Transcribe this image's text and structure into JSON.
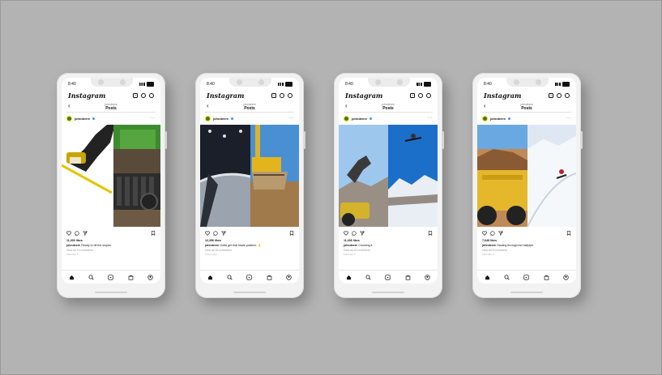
{
  "phones": [
    {
      "time": "8:40",
      "logo": "Instagram",
      "sub_user": "johndeere",
      "sub_title": "Posts",
      "account": "johndeere",
      "likes": "11,400 likes",
      "caption_user": "johndeere",
      "caption_text": "Ready to hit the slopes.",
      "comments": "View all 13 comments",
      "date": "February 6"
    },
    {
      "time": "8:40",
      "logo": "Instagram",
      "sub_user": "johndeere",
      "sub_title": "Posts",
      "account": "johndeere",
      "likes": "12,356 likes",
      "caption_user": "johndeere",
      "caption_text": "Gotta get that blade position. 👌",
      "comments": "View all 18 comments",
      "date": "2 days ago"
    },
    {
      "time": "8:40",
      "logo": "Instagram",
      "sub_user": "johndeere",
      "sub_title": "Posts",
      "account": "johndeere",
      "likes": "11,406 likes",
      "caption_user": "johndeere",
      "caption_text": "Crushing it.",
      "comments": "View all 22 comments",
      "date": "February 6"
    },
    {
      "time": "8:40",
      "logo": "Instagram",
      "sub_user": "johndeere",
      "sub_title": "Posts",
      "account": "johndeere",
      "likes": "7,648 likes",
      "caption_user": "johndeere",
      "caption_text": "Hauling through the halfpipe.",
      "comments": "View all 8 comments",
      "date": "February 6"
    }
  ],
  "colors": {
    "background": "#b3b3b3",
    "phone_body": "#f2f2f2",
    "deere_green": "#367c2b",
    "deere_yellow": "#ffde00",
    "verified_blue": "#3897f0"
  },
  "icons": {
    "header": [
      "add-post-icon",
      "heart-icon",
      "messenger-icon"
    ],
    "actions": [
      "like-icon",
      "comment-icon",
      "share-icon",
      "save-icon"
    ],
    "tabs": [
      "home-icon",
      "search-icon",
      "reels-icon",
      "shop-icon",
      "profile-icon"
    ]
  }
}
